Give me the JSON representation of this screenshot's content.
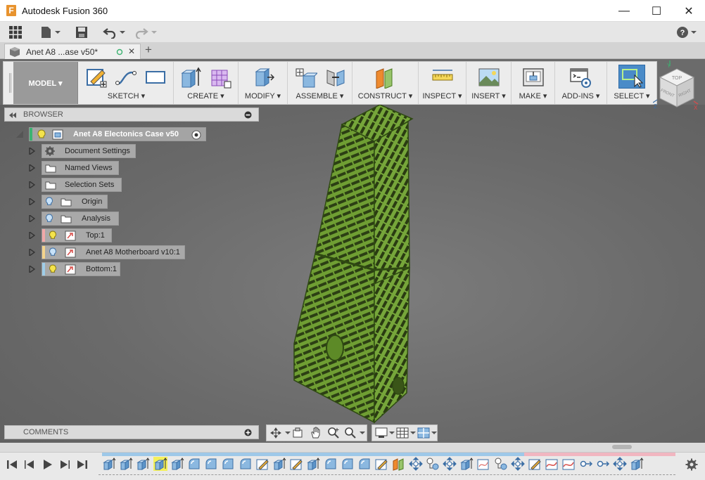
{
  "window": {
    "app_title": "Autodesk Fusion 360",
    "logo_letter": "F",
    "minimize": "—",
    "maximize": "☐",
    "close": "✕"
  },
  "doc_tab": {
    "label": "Anet A8 ...ase v50*",
    "close": "✕",
    "new_tab": "+"
  },
  "ribbon": {
    "workspace": "MODEL ▾",
    "groups": [
      {
        "label": "SKETCH ▾"
      },
      {
        "label": "CREATE ▾"
      },
      {
        "label": "MODIFY ▾"
      },
      {
        "label": "ASSEMBLE ▾"
      },
      {
        "label": "CONSTRUCT ▾"
      },
      {
        "label": "INSPECT ▾"
      },
      {
        "label": "INSERT ▾"
      },
      {
        "label": "MAKE ▾"
      },
      {
        "label": "ADD-INS ▾"
      },
      {
        "label": "SELECT ▾"
      }
    ]
  },
  "browser": {
    "title": "BROWSER",
    "root": "Anet A8 Electonics Case v50",
    "items": [
      {
        "label": "Document Settings",
        "icon": "gear-icon"
      },
      {
        "label": "Named Views",
        "icon": "folder-icon"
      },
      {
        "label": "Selection Sets",
        "icon": "folder-icon"
      },
      {
        "label": "Origin",
        "icon": "folder-icon"
      },
      {
        "label": "Analysis",
        "icon": "folder-icon"
      },
      {
        "label": "Top:1",
        "icon": "component-icon",
        "band": "#f0a8a8"
      },
      {
        "label": "Anet A8 Motherboard v10:1",
        "icon": "component-icon",
        "band": "#f3d38c"
      },
      {
        "label": "Bottom:1",
        "icon": "component-icon",
        "band": "#9fcde8"
      }
    ]
  },
  "comments": {
    "title": "COMMENTS"
  },
  "viewcube": {
    "top": "TOP",
    "front": "FRONT",
    "right": "RIGHT",
    "axis_x": "X",
    "axis_y": "Y",
    "axis_z": "Z"
  },
  "colors": {
    "model_green": "#6f9e33",
    "model_edge": "#2f4a12",
    "select_blue": "#4a8bc8",
    "timeline_blue": "#9ec8e8",
    "timeline_pink": "#f1b6c0",
    "highlight_yellow": "#f4f05a"
  }
}
